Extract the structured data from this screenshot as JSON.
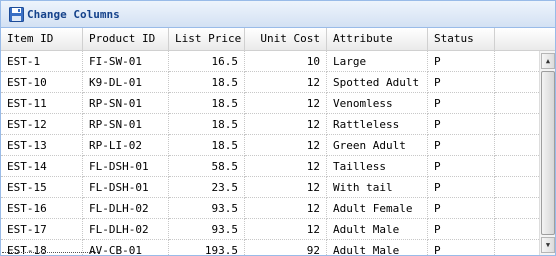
{
  "panel": {
    "title": "Change Columns",
    "title_icon": "disk-icon"
  },
  "grid": {
    "columns": [
      {
        "key": "item_id",
        "label": "Item ID",
        "align": "left"
      },
      {
        "key": "product_id",
        "label": "Product ID",
        "align": "left"
      },
      {
        "key": "list_price",
        "label": "List Price",
        "align": "right"
      },
      {
        "key": "unit_cost",
        "label": "Unit Cost",
        "align": "right"
      },
      {
        "key": "attribute",
        "label": "Attribute",
        "align": "left"
      },
      {
        "key": "status",
        "label": "Status",
        "align": "left"
      }
    ],
    "rows": [
      {
        "item_id": "EST-1",
        "product_id": "FI-SW-01",
        "list_price": "16.5",
        "unit_cost": "10",
        "attribute": "Large",
        "status": "P"
      },
      {
        "item_id": "EST-10",
        "product_id": "K9-DL-01",
        "list_price": "18.5",
        "unit_cost": "12",
        "attribute": "Spotted Adult Fe",
        "status": "P"
      },
      {
        "item_id": "EST-11",
        "product_id": "RP-SN-01",
        "list_price": "18.5",
        "unit_cost": "12",
        "attribute": "Venomless",
        "status": "P"
      },
      {
        "item_id": "EST-12",
        "product_id": "RP-SN-01",
        "list_price": "18.5",
        "unit_cost": "12",
        "attribute": "Rattleless",
        "status": "P"
      },
      {
        "item_id": "EST-13",
        "product_id": "RP-LI-02",
        "list_price": "18.5",
        "unit_cost": "12",
        "attribute": "Green Adult",
        "status": "P"
      },
      {
        "item_id": "EST-14",
        "product_id": "FL-DSH-01",
        "list_price": "58.5",
        "unit_cost": "12",
        "attribute": "Tailless",
        "status": "P"
      },
      {
        "item_id": "EST-15",
        "product_id": "FL-DSH-01",
        "list_price": "23.5",
        "unit_cost": "12",
        "attribute": "With tail",
        "status": "P"
      },
      {
        "item_id": "EST-16",
        "product_id": "FL-DLH-02",
        "list_price": "93.5",
        "unit_cost": "12",
        "attribute": "Adult Female",
        "status": "P"
      },
      {
        "item_id": "EST-17",
        "product_id": "FL-DLH-02",
        "list_price": "93.5",
        "unit_cost": "12",
        "attribute": "Adult Male",
        "status": "P"
      },
      {
        "item_id": "EST-18",
        "product_id": "AV-CB-01",
        "list_price": "193.5",
        "unit_cost": "92",
        "attribute": "Adult Male",
        "status": "P"
      }
    ]
  },
  "colors": {
    "panel_border": "#99bbe8",
    "title_text": "#15428b",
    "header_bg": "#eaeaea",
    "grid_line": "#c8c8c8"
  }
}
